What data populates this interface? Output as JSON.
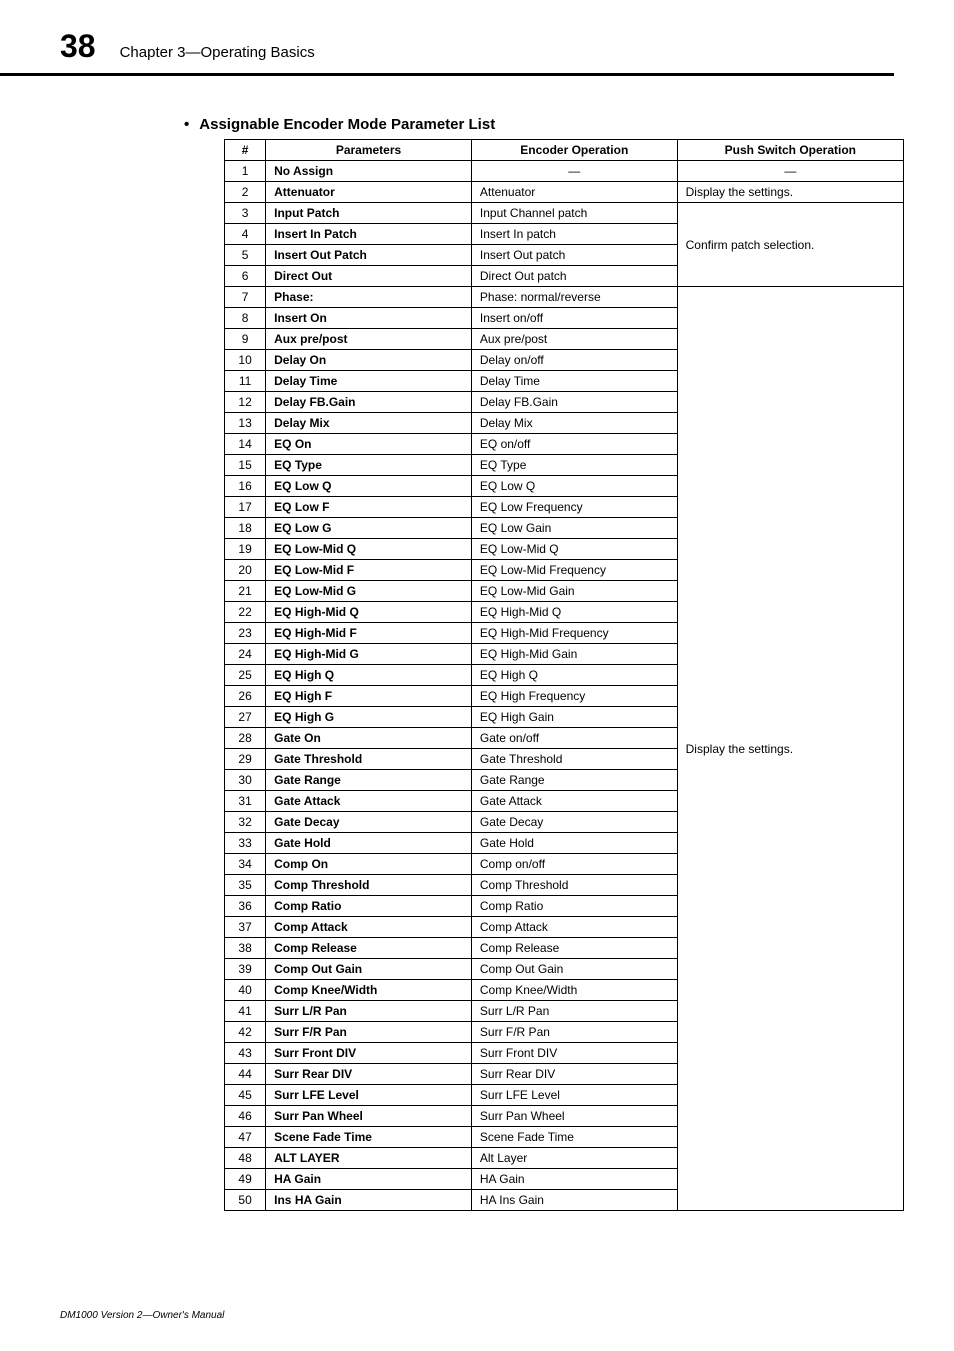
{
  "page_number": "38",
  "chapter_title": "Chapter 3—Operating Basics",
  "section_title": "Assignable Encoder Mode Parameter List",
  "headers": {
    "num": "#",
    "parameters": "Parameters",
    "encoder": "Encoder Operation",
    "push": "Push Switch Operation"
  },
  "push_groups": {
    "row1": "—",
    "row2": "Display the settings.",
    "rows3_6": "Confirm patch selection.",
    "rows7_50": "Display the settings."
  },
  "rows": [
    {
      "n": "1",
      "p": "No Assign",
      "e": "—"
    },
    {
      "n": "2",
      "p": "Attenuator",
      "e": "Attenuator"
    },
    {
      "n": "3",
      "p": "Input Patch",
      "e": "Input Channel patch"
    },
    {
      "n": "4",
      "p": "Insert In Patch",
      "e": "Insert In patch"
    },
    {
      "n": "5",
      "p": "Insert Out Patch",
      "e": "Insert Out patch"
    },
    {
      "n": "6",
      "p": "Direct Out",
      "e": "Direct Out patch"
    },
    {
      "n": "7",
      "p": "Phase:",
      "e": "Phase: normal/reverse"
    },
    {
      "n": "8",
      "p": "Insert On",
      "e": "Insert on/off"
    },
    {
      "n": "9",
      "p": "Aux pre/post",
      "e": "Aux pre/post"
    },
    {
      "n": "10",
      "p": "Delay On",
      "e": "Delay on/off"
    },
    {
      "n": "11",
      "p": "Delay Time",
      "e": "Delay Time"
    },
    {
      "n": "12",
      "p": "Delay FB.Gain",
      "e": "Delay FB.Gain"
    },
    {
      "n": "13",
      "p": "Delay Mix",
      "e": "Delay Mix"
    },
    {
      "n": "14",
      "p": "EQ On",
      "e": "EQ on/off"
    },
    {
      "n": "15",
      "p": "EQ Type",
      "e": "EQ Type"
    },
    {
      "n": "16",
      "p": "EQ Low Q",
      "e": "EQ Low Q"
    },
    {
      "n": "17",
      "p": "EQ Low F",
      "e": "EQ Low Frequency"
    },
    {
      "n": "18",
      "p": "EQ Low G",
      "e": "EQ Low Gain"
    },
    {
      "n": "19",
      "p": "EQ Low-Mid Q",
      "e": "EQ Low-Mid Q"
    },
    {
      "n": "20",
      "p": "EQ Low-Mid F",
      "e": "EQ Low-Mid Frequency"
    },
    {
      "n": "21",
      "p": "EQ Low-Mid G",
      "e": "EQ Low-Mid Gain"
    },
    {
      "n": "22",
      "p": "EQ High-Mid Q",
      "e": "EQ High-Mid Q"
    },
    {
      "n": "23",
      "p": "EQ High-Mid F",
      "e": "EQ High-Mid Frequency"
    },
    {
      "n": "24",
      "p": "EQ High-Mid G",
      "e": "EQ High-Mid Gain"
    },
    {
      "n": "25",
      "p": "EQ High Q",
      "e": "EQ High Q"
    },
    {
      "n": "26",
      "p": "EQ High F",
      "e": "EQ High Frequency"
    },
    {
      "n": "27",
      "p": "EQ High G",
      "e": "EQ High Gain"
    },
    {
      "n": "28",
      "p": "Gate On",
      "e": "Gate on/off"
    },
    {
      "n": "29",
      "p": "Gate Threshold",
      "e": "Gate Threshold"
    },
    {
      "n": "30",
      "p": "Gate Range",
      "e": "Gate Range"
    },
    {
      "n": "31",
      "p": "Gate Attack",
      "e": "Gate Attack"
    },
    {
      "n": "32",
      "p": "Gate Decay",
      "e": "Gate Decay"
    },
    {
      "n": "33",
      "p": "Gate Hold",
      "e": "Gate Hold"
    },
    {
      "n": "34",
      "p": "Comp On",
      "e": "Comp on/off"
    },
    {
      "n": "35",
      "p": "Comp Threshold",
      "e": "Comp Threshold"
    },
    {
      "n": "36",
      "p": "Comp Ratio",
      "e": "Comp Ratio"
    },
    {
      "n": "37",
      "p": "Comp Attack",
      "e": "Comp Attack"
    },
    {
      "n": "38",
      "p": "Comp Release",
      "e": "Comp Release"
    },
    {
      "n": "39",
      "p": "Comp Out Gain",
      "e": "Comp Out Gain"
    },
    {
      "n": "40",
      "p": "Comp Knee/Width",
      "e": "Comp Knee/Width"
    },
    {
      "n": "41",
      "p": "Surr L/R Pan",
      "e": "Surr L/R Pan"
    },
    {
      "n": "42",
      "p": "Surr F/R Pan",
      "e": "Surr F/R Pan"
    },
    {
      "n": "43",
      "p": "Surr Front DIV",
      "e": "Surr Front DIV"
    },
    {
      "n": "44",
      "p": "Surr Rear DIV",
      "e": "Surr Rear DIV"
    },
    {
      "n": "45",
      "p": "Surr LFE Level",
      "e": "Surr LFE Level"
    },
    {
      "n": "46",
      "p": "Surr Pan Wheel",
      "e": "Surr Pan Wheel"
    },
    {
      "n": "47",
      "p": "Scene Fade Time",
      "e": "Scene Fade Time"
    },
    {
      "n": "48",
      "p": "ALT LAYER",
      "e": "Alt Layer"
    },
    {
      "n": "49",
      "p": "HA Gain",
      "e": "HA Gain"
    },
    {
      "n": "50",
      "p": "Ins HA Gain",
      "e": "HA Ins Gain"
    }
  ],
  "footer": "DM1000 Version 2—Owner's Manual"
}
